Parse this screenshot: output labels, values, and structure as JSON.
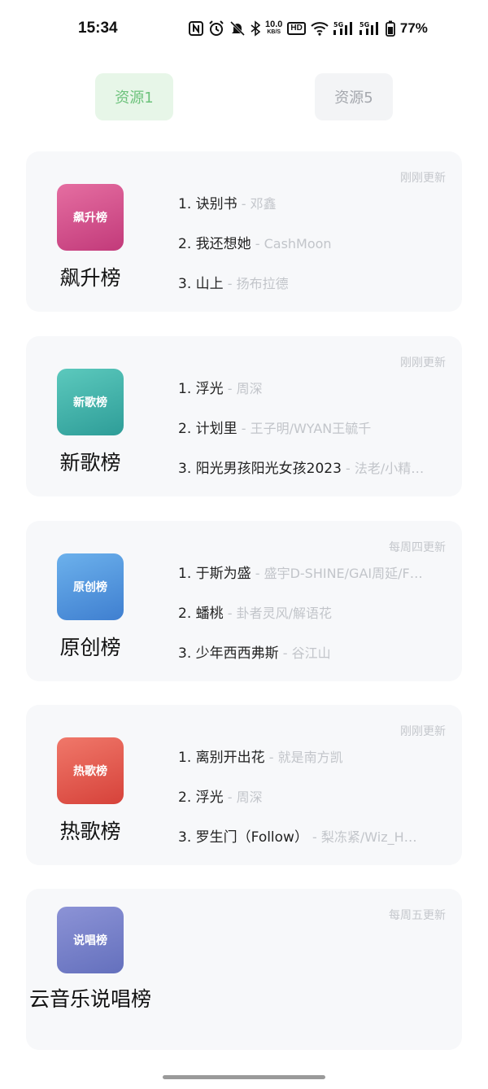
{
  "status_bar": {
    "time": "15:34",
    "network_speed_top": "10.0",
    "network_speed_bottom": "KB/S",
    "hd_label": "HD",
    "battery": "77%",
    "icons": [
      "nfc-icon",
      "alarm-icon",
      "mute-icon",
      "bluetooth-icon",
      "network-speed",
      "hd-icon",
      "wifi-icon",
      "signal-5g-icon",
      "signal-5g-icon",
      "battery-icon"
    ]
  },
  "tabs": [
    {
      "label": "资源1",
      "active": true
    },
    {
      "label": "资源5",
      "active": false
    }
  ],
  "charts": [
    {
      "cover_label": "飙升榜",
      "name": "飙升榜",
      "update": "刚刚更新",
      "gradient": [
        "#e56ea1",
        "#c23a7a"
      ],
      "songs": [
        {
          "rank": "1.",
          "title": "诀别书",
          "artist": " - 邓鑫"
        },
        {
          "rank": "2.",
          "title": "我还想她",
          "artist": " - CashMoon"
        },
        {
          "rank": "3.",
          "title": "山上",
          "artist": " - 扬布拉德"
        }
      ]
    },
    {
      "cover_label": "新歌榜",
      "name": "新歌榜",
      "update": "刚刚更新",
      "gradient": [
        "#5cc9bd",
        "#2e9d98"
      ],
      "songs": [
        {
          "rank": "1.",
          "title": "浮光",
          "artist": " - 周深"
        },
        {
          "rank": "2.",
          "title": "计划里",
          "artist": " - 王子明/WYAN王毓千"
        },
        {
          "rank": "3.",
          "title": "阳光男孩阳光女孩2023",
          "artist": " - 法老/小精…"
        }
      ]
    },
    {
      "cover_label": "原创榜",
      "name": "原创榜",
      "update": "每周四更新",
      "gradient": [
        "#6cb1ec",
        "#3f7fd0"
      ],
      "songs": [
        {
          "rank": "1.",
          "title": "于斯为盛",
          "artist": " - 盛宇D-SHINE/GAI周延/F…"
        },
        {
          "rank": "2.",
          "title": "蟠桃",
          "artist": " - 卦者灵风/解语花"
        },
        {
          "rank": "3.",
          "title": "少年西西弗斯",
          "artist": " - 谷江山"
        }
      ]
    },
    {
      "cover_label": "热歌榜",
      "name": "热歌榜",
      "update": "刚刚更新",
      "gradient": [
        "#f0786a",
        "#d6423a"
      ],
      "songs": [
        {
          "rank": "1.",
          "title": "离别开出花",
          "artist": " - 就是南方凯"
        },
        {
          "rank": "2.",
          "title": "浮光",
          "artist": " - 周深"
        },
        {
          "rank": "3.",
          "title": "罗生门（Follow）",
          "artist": " - 梨冻紧/Wiz_H…"
        }
      ]
    },
    {
      "cover_label": "说唱榜",
      "name": "云音乐说唱榜",
      "update": "每周五更新",
      "gradient": [
        "#8c93d6",
        "#6470bd"
      ],
      "songs": []
    }
  ]
}
